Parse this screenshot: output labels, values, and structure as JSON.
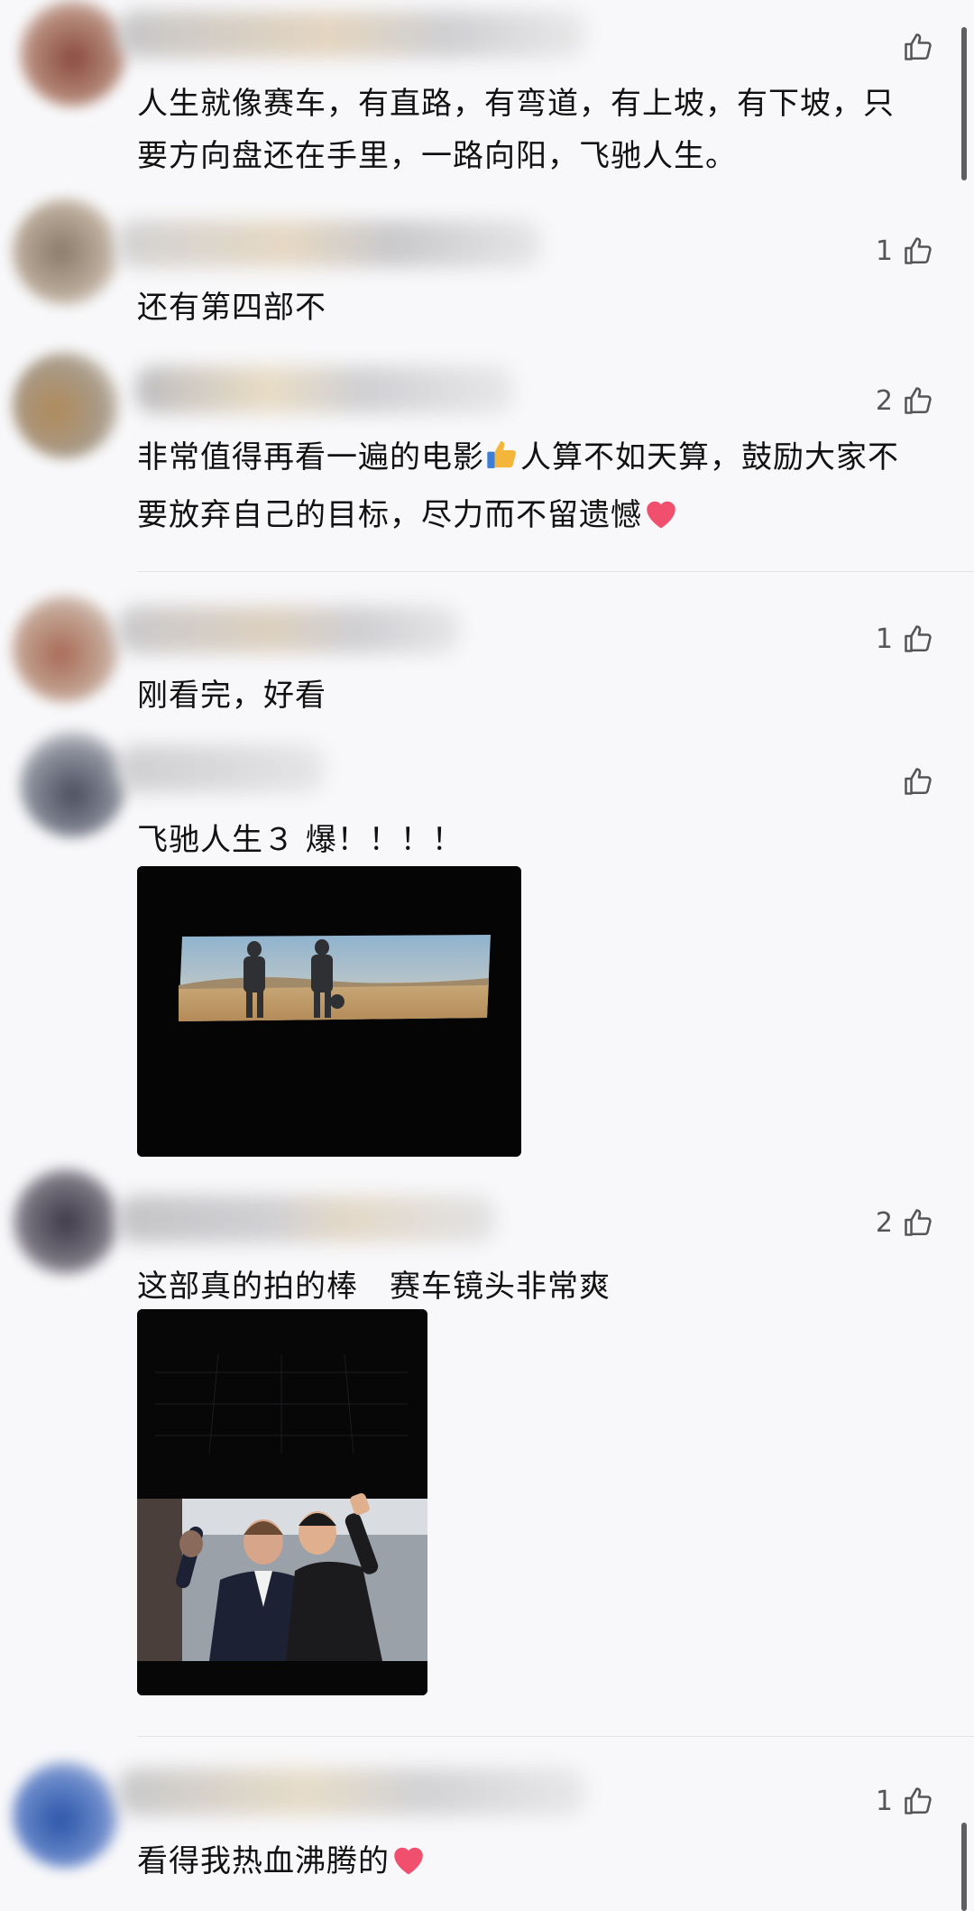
{
  "comments": [
    {
      "likes": "",
      "text": "人生就像赛车，有直路，有弯道，有上坡，有下坡，只要方向盘还在手里，一路向阳，飞驰人生。"
    },
    {
      "likes": "1",
      "text": "还有第四部不"
    },
    {
      "likes": "2",
      "text_part1": "非常值得再看一遍的电影",
      "text_part2": "人算不如天算，鼓励大家不要放弃自己的目标，尽力而不留遗憾"
    },
    {
      "likes": "1",
      "text": "刚看完，好看"
    },
    {
      "likes": "",
      "text": "飞驰人生３ 爆！！！！"
    },
    {
      "likes": "2",
      "text": "这部真的拍的棒　赛车镜头非常爽"
    },
    {
      "likes": "1",
      "text": "看得我热血沸腾的"
    }
  ],
  "icons": {
    "like": "thumbs-up-outline-icon",
    "thumbs_emoji": "thumbs-up-emoji-icon",
    "heart_emoji": "red-heart-emoji-icon"
  },
  "colors": {
    "background": "#f8f8fa",
    "text": "#111111",
    "like_count": "#555555",
    "heart": "#f0506e",
    "thumb": "#f3b53a"
  }
}
